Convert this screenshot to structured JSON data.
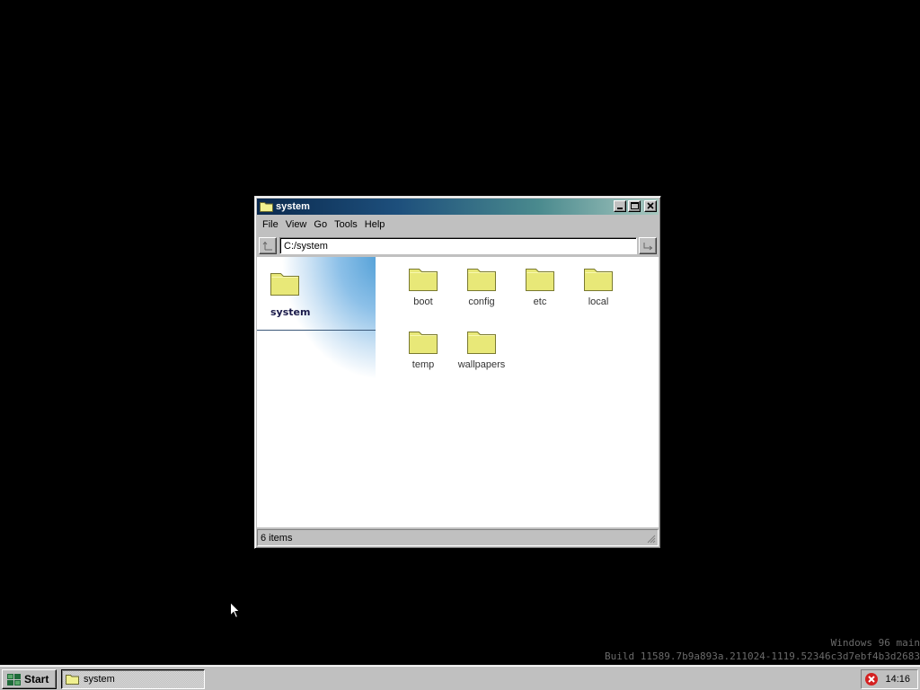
{
  "window": {
    "title": "system",
    "menu": [
      "File",
      "View",
      "Go",
      "Tools",
      "Help"
    ],
    "address": "C:/system",
    "sidebar_title": "system",
    "status": "6 items",
    "items": [
      {
        "name": "boot",
        "icon": "folder-icon"
      },
      {
        "name": "config",
        "icon": "folder-icon"
      },
      {
        "name": "etc",
        "icon": "folder-icon"
      },
      {
        "name": "local",
        "icon": "folder-icon"
      },
      {
        "name": "temp",
        "icon": "folder-icon"
      },
      {
        "name": "wallpapers",
        "icon": "folder-icon"
      }
    ]
  },
  "watermark": {
    "line1": "Windows 96 main",
    "line2": "Build 11589.7b9a893a.211024-1119.52346c3d7ebf4b3d2683"
  },
  "taskbar": {
    "start_label": "Start",
    "task_label": "system",
    "clock": "14:16"
  },
  "colors": {
    "desktop": "#000000",
    "titlebar_start": "#0b2a4e",
    "titlebar_end": "#a8c8c0",
    "folder": "#e8e878"
  }
}
